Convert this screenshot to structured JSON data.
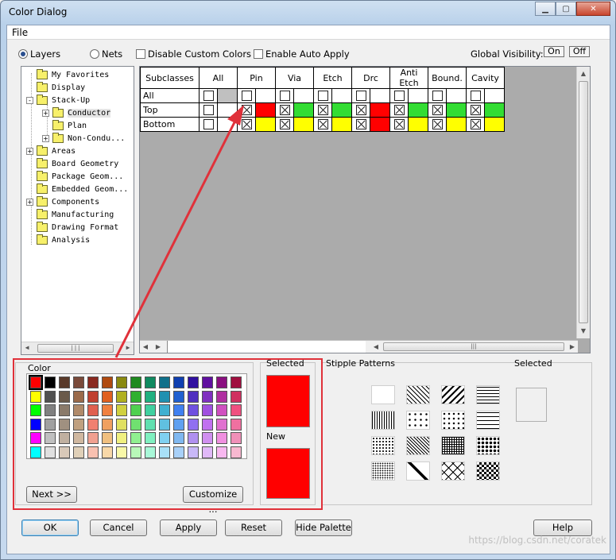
{
  "window": {
    "title": "Color Dialog",
    "menu_file": "File"
  },
  "view_toggle": {
    "layers_label": "Layers",
    "nets_label": "Nets",
    "selected": "layers"
  },
  "options": {
    "disable_custom_colors": "Disable Custom Colors",
    "enable_auto_apply": "Enable Auto Apply"
  },
  "global_visibility": {
    "label": "Global Visibility:",
    "on": "On",
    "off": "Off"
  },
  "tree": {
    "items": [
      {
        "label": "My Favorites",
        "indent": 0,
        "expander": ""
      },
      {
        "label": "Display",
        "indent": 0,
        "expander": ""
      },
      {
        "label": "Stack-Up",
        "indent": 0,
        "expander": "-"
      },
      {
        "label": "Conductor",
        "indent": 1,
        "expander": "+",
        "selected": true
      },
      {
        "label": "Plan",
        "indent": 1,
        "expander": ""
      },
      {
        "label": "Non-Condu...",
        "indent": 1,
        "expander": "+"
      },
      {
        "label": "Areas",
        "indent": 0,
        "expander": "+"
      },
      {
        "label": "Board Geometry",
        "indent": 0,
        "expander": ""
      },
      {
        "label": "Package Geom...",
        "indent": 0,
        "expander": ""
      },
      {
        "label": "Embedded Geom...",
        "indent": 0,
        "expander": ""
      },
      {
        "label": "Components",
        "indent": 0,
        "expander": "+"
      },
      {
        "label": "Manufacturing",
        "indent": 0,
        "expander": ""
      },
      {
        "label": "Drawing Format",
        "indent": 0,
        "expander": ""
      },
      {
        "label": "Analysis",
        "indent": 0,
        "expander": ""
      }
    ]
  },
  "grid": {
    "columns": [
      "Subclasses",
      "All",
      "Pin",
      "Via",
      "Etch",
      "Drc",
      "Anti Etch",
      "Bound.",
      "Cavity"
    ],
    "rows": [
      {
        "name": "All",
        "checks": [
          false,
          null,
          false,
          false,
          false,
          false,
          false,
          false,
          false
        ],
        "colors": [
          "#c0c0c0",
          "#ffffff",
          "#ffffff",
          "#ffffff",
          "#ffffff",
          "#ffffff",
          "#ffffff",
          "#ffffff"
        ]
      },
      {
        "name": "Top",
        "checks": [
          false,
          null,
          true,
          true,
          true,
          true,
          true,
          true,
          true
        ],
        "colors": [
          "#ffffff",
          "#ff0000",
          "#33dd33",
          "#33dd33",
          "#ff0000",
          "#33dd33",
          "#33dd33",
          "#33dd33"
        ]
      },
      {
        "name": "Bottom",
        "checks": [
          false,
          null,
          true,
          true,
          true,
          true,
          true,
          true,
          true
        ],
        "colors": [
          "#ffffff",
          "#ffff00",
          "#ffff00",
          "#ffff00",
          "#ff0000",
          "#ffff00",
          "#ffff00",
          "#ffff00"
        ]
      }
    ]
  },
  "color_panel": {
    "label": "Color",
    "selected_label": "Selected",
    "new_label": "New",
    "selected_color": "#ff0000",
    "new_color": "#ff0000",
    "next_button": "Next >>",
    "customize_button": "Customize ...",
    "palette": [
      [
        "#ff0000",
        "#000000",
        "#5a3a2a",
        "#7a4a3a",
        "#8a2a20",
        "#b04a10",
        "#8a8a10",
        "#208a20",
        "#108a60",
        "#10708a",
        "#1040b0",
        "#3010a0",
        "#6010a0",
        "#8a1080",
        "#a01040"
      ],
      [
        "#ffff00",
        "#505050",
        "#6a5a4a",
        "#9a6a4a",
        "#c04030",
        "#e06020",
        "#b0b020",
        "#30b030",
        "#20b080",
        "#2090b0",
        "#2060d0",
        "#5030c0",
        "#8030c0",
        "#b030a0",
        "#d03060"
      ],
      [
        "#00ff00",
        "#808080",
        "#8a7a6a",
        "#b08a6a",
        "#e06050",
        "#f08040",
        "#d0d040",
        "#50d050",
        "#40d0a0",
        "#40b0d0",
        "#4080f0",
        "#7050e0",
        "#a050e0",
        "#d050c0",
        "#f05080"
      ],
      [
        "#0000ff",
        "#a0a0a0",
        "#a09080",
        "#c0a080",
        "#f08070",
        "#f0a060",
        "#e0e060",
        "#70e070",
        "#60e0b0",
        "#60c0e0",
        "#60a0f0",
        "#9070f0",
        "#c070f0",
        "#e070d0",
        "#f070a0"
      ],
      [
        "#ff00ff",
        "#c0c0c0",
        "#c0b0a0",
        "#d0b8a0",
        "#f0a090",
        "#f0c080",
        "#f0f080",
        "#90f090",
        "#80f0c0",
        "#80d0f0",
        "#80b8f0",
        "#b090f0",
        "#d090f0",
        "#f090e0",
        "#f090b8"
      ],
      [
        "#00ffff",
        "#e0e0e0",
        "#d8c8b8",
        "#e0d0b8",
        "#f8c0b0",
        "#f8d8a8",
        "#f8f8a8",
        "#b8f8b8",
        "#a8f8d8",
        "#a8e0f8",
        "#a8d0f8",
        "#c8b8f8",
        "#e0b8f8",
        "#f8b8f0",
        "#f8b8d0"
      ]
    ]
  },
  "stipple": {
    "label": "Stipple Patterns",
    "selected_label": "Selected"
  },
  "footer": {
    "ok": "OK",
    "cancel": "Cancel",
    "apply": "Apply",
    "reset": "Reset",
    "hide_palette": "Hide Palette",
    "help": "Help"
  },
  "watermark": "https://blog.csdn.net/coratek",
  "annotation_color": "#e0313a"
}
